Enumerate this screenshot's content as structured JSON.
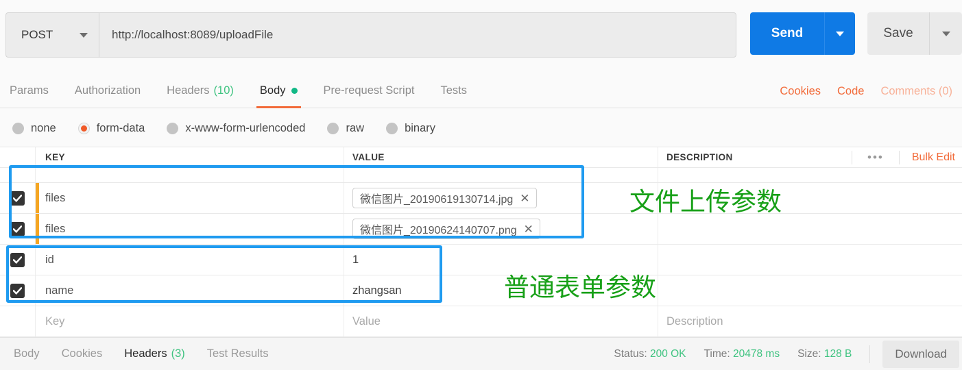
{
  "request": {
    "method": "POST",
    "url": "http://localhost:8089/uploadFile",
    "send_label": "Send",
    "save_label": "Save"
  },
  "tabs": [
    {
      "label": "Params",
      "count": "",
      "active": false,
      "dot": false
    },
    {
      "label": "Authorization",
      "count": "",
      "active": false,
      "dot": false
    },
    {
      "label": "Headers",
      "count": "(10)",
      "active": false,
      "dot": false
    },
    {
      "label": "Body",
      "count": "",
      "active": true,
      "dot": true
    },
    {
      "label": "Pre-request Script",
      "count": "",
      "active": false,
      "dot": false
    },
    {
      "label": "Tests",
      "count": "",
      "active": false,
      "dot": false
    }
  ],
  "tabs_right": {
    "cookies": "Cookies",
    "code": "Code",
    "comments": "Comments (0)"
  },
  "body_types": [
    {
      "label": "none",
      "selected": false
    },
    {
      "label": "form-data",
      "selected": true
    },
    {
      "label": "x-www-form-urlencoded",
      "selected": false
    },
    {
      "label": "raw",
      "selected": false
    },
    {
      "label": "binary",
      "selected": false
    }
  ],
  "table": {
    "headers": {
      "key": "KEY",
      "value": "VALUE",
      "description": "DESCRIPTION"
    },
    "bulk_edit": "Bulk Edit",
    "dots": "•••",
    "rows": [
      {
        "checked": true,
        "file": true,
        "key": "files",
        "value": "微信图片_20190619130714.jpg",
        "description": ""
      },
      {
        "checked": true,
        "file": true,
        "key": "files",
        "value": "微信图片_20190624140707.png",
        "description": ""
      },
      {
        "checked": true,
        "file": false,
        "key": "id",
        "value": "1",
        "description": ""
      },
      {
        "checked": true,
        "file": false,
        "key": "name",
        "value": "zhangsan",
        "description": ""
      }
    ],
    "placeholders": {
      "key": "Key",
      "value": "Value",
      "description": "Description"
    }
  },
  "annotations": [
    {
      "text": "文件上传参数",
      "color": "#17a017"
    },
    {
      "text": "普通表单参数",
      "color": "#17a017"
    }
  ],
  "response": {
    "tabs": [
      {
        "label": "Body",
        "count": "",
        "active": false
      },
      {
        "label": "Cookies",
        "count": "",
        "active": false
      },
      {
        "label": "Headers",
        "count": "(3)",
        "active": true
      },
      {
        "label": "Test Results",
        "count": "",
        "active": false
      }
    ],
    "status_label": "Status:",
    "status_value": "200 OK",
    "time_label": "Time:",
    "time_value": "20478 ms",
    "size_label": "Size:",
    "size_value": "128 B",
    "download_label": "Download"
  },
  "colors": {
    "send_blue": "#0f7ae5",
    "accent_orange": "#f26b3a",
    "green": "#3fc380",
    "annotation_blue": "#1f9bf0",
    "annotation_green": "#17a017"
  }
}
